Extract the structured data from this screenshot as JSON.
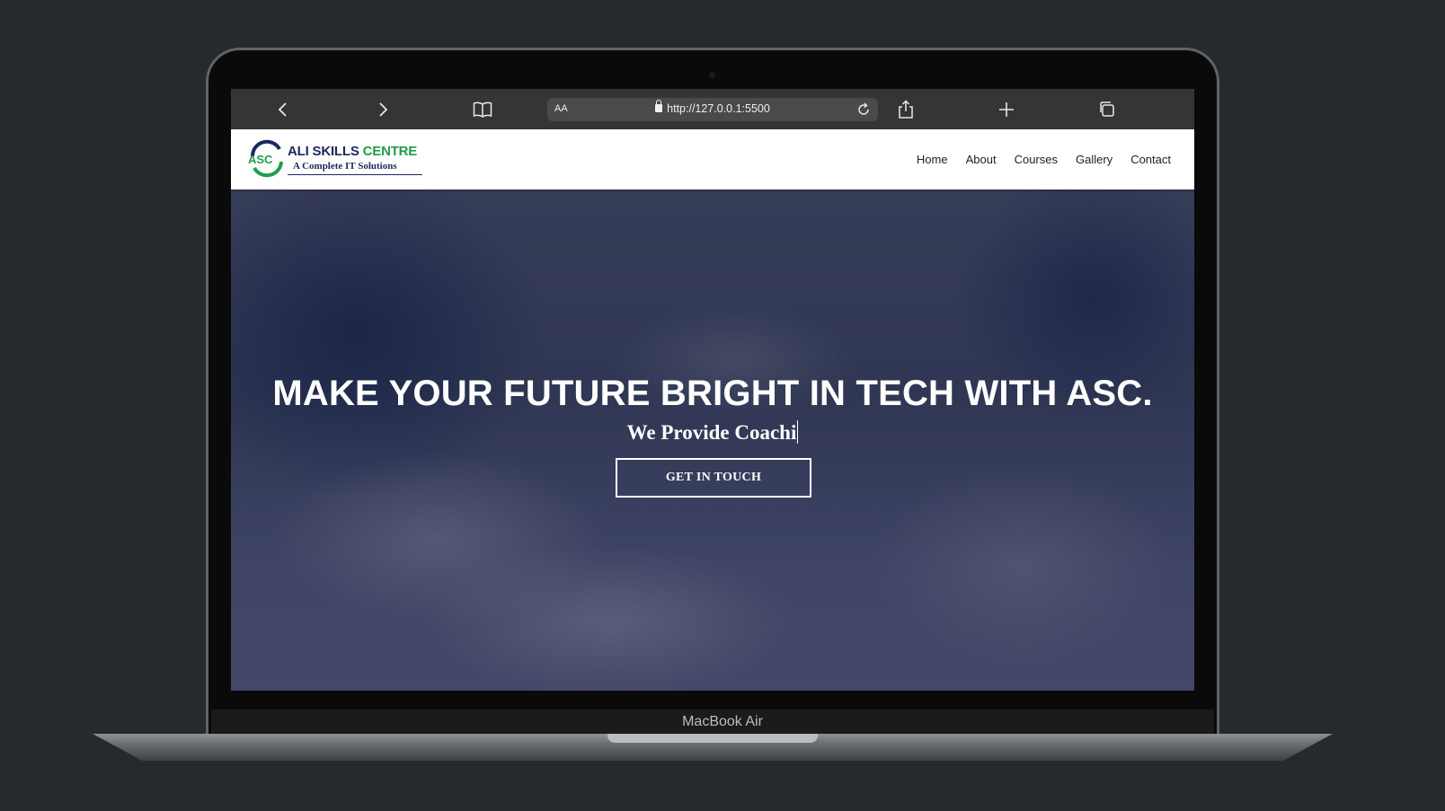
{
  "browser": {
    "aa_label": "AA",
    "url": "http://127.0.0.1:5500"
  },
  "site": {
    "logo": {
      "badge": "ASC",
      "title_part1": "ALI SKILLS",
      "title_part2": "CENTRE",
      "subtitle": "A Complete IT Solutions"
    },
    "nav": [
      {
        "label": "Home"
      },
      {
        "label": "About"
      },
      {
        "label": "Courses"
      },
      {
        "label": "Gallery"
      },
      {
        "label": "Contact"
      }
    ]
  },
  "hero": {
    "title": "MAKE YOUR FUTURE BRIGHT IN TECH WITH ASC.",
    "subtitle": "We Provide Coachi",
    "cta_label": "GET IN TOUCH"
  },
  "device": {
    "label": "MacBook Air"
  },
  "colors": {
    "brand_navy": "#1a2a5e",
    "brand_green": "#1e9e4a",
    "hero_overlay": "#1c2450"
  },
  "icons": [
    "back-icon",
    "forward-icon",
    "bookmarks-icon",
    "lock-icon",
    "reload-icon",
    "share-icon",
    "new-tab-icon",
    "tabs-icon"
  ]
}
